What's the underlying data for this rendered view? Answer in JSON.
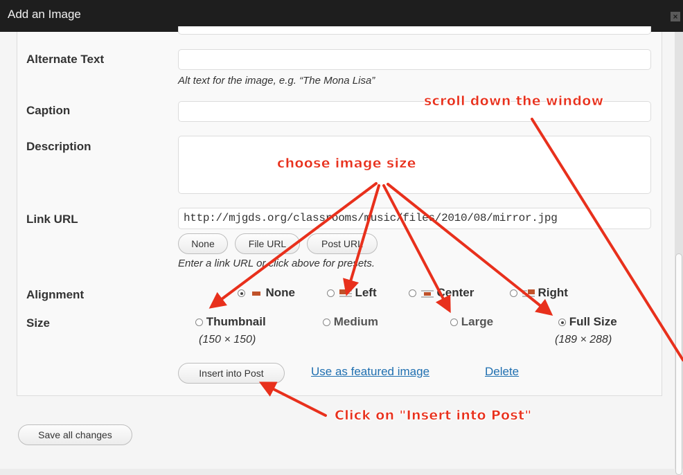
{
  "window": {
    "title": "Add an Image",
    "close_glyph": "×"
  },
  "form": {
    "alt_text": {
      "label": "Alternate Text",
      "value": "",
      "help": "Alt text for the image, e.g. “The Mona Lisa”"
    },
    "caption": {
      "label": "Caption",
      "value": ""
    },
    "description": {
      "label": "Description",
      "value": ""
    },
    "link_url": {
      "label": "Link URL",
      "value": "http://mjgds.org/classrooms/music/files/2010/08/mirror.jpg",
      "buttons": [
        "None",
        "File URL",
        "Post URL"
      ],
      "help": "Enter a link URL or click above for presets."
    },
    "alignment": {
      "label": "Alignment",
      "options": [
        "None",
        "Left",
        "Center",
        "Right"
      ],
      "selected": "None"
    },
    "size": {
      "label": "Size",
      "options": [
        {
          "label": "Thumbnail",
          "dims": "(150 × 150)"
        },
        {
          "label": "Medium",
          "dims": ""
        },
        {
          "label": "Large",
          "dims": ""
        },
        {
          "label": "Full Size",
          "dims": "(189 × 288)"
        }
      ],
      "selected": "Full Size"
    },
    "actions": {
      "insert": "Insert into Post",
      "featured": "Use as featured image",
      "delete": "Delete"
    }
  },
  "save_all": "Save all changes",
  "annotations": {
    "scroll": "scroll down the window",
    "choose_size": "choose image size",
    "click_insert": "Click on \"Insert into Post\""
  },
  "colors": {
    "annotation": "#e8301c",
    "link": "#1f6fb0",
    "titlebar": "#1e1e1e",
    "align_icon": "#c0522a"
  }
}
